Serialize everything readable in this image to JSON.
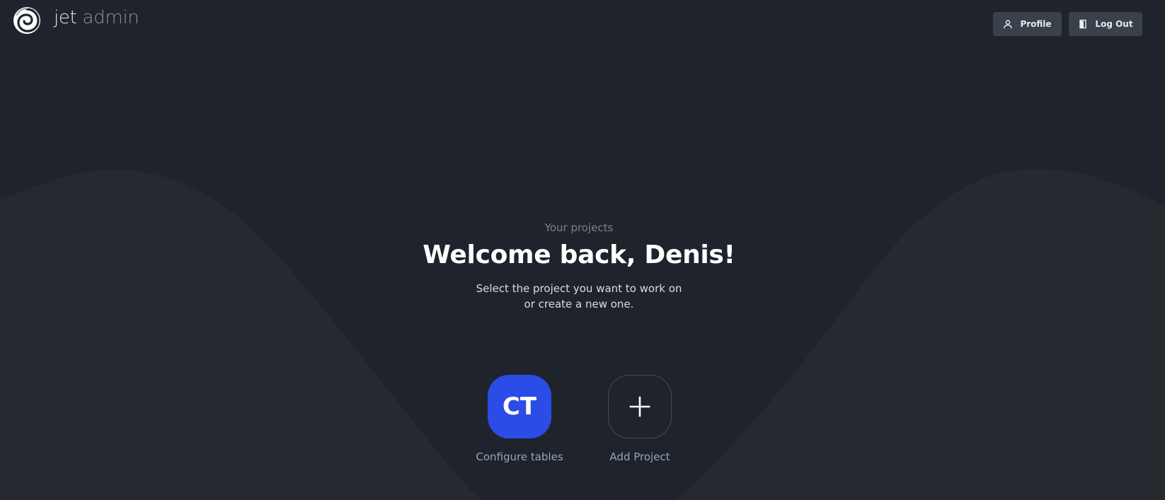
{
  "header": {
    "logo": {
      "word_primary": "jet",
      "word_secondary": "admin"
    },
    "profile_button": {
      "label": "Profile",
      "icon": "user-icon"
    },
    "logout_button": {
      "label": "Log Out",
      "icon": "door-exit-icon"
    }
  },
  "main": {
    "subtitle": "Your projects",
    "title": "Welcome back, Denis!",
    "description": "Select the project you want to work on or create a new one."
  },
  "projects": [
    {
      "initials": "CT",
      "label": "Configure tables",
      "color": "#2b4ce7"
    }
  ],
  "add_project": {
    "label": "Add Project",
    "icon": "plus-icon"
  },
  "colors": {
    "background": "#1f232b",
    "wave": "#252a31",
    "button": "#3a414b",
    "accent": "#2b4ce7"
  }
}
